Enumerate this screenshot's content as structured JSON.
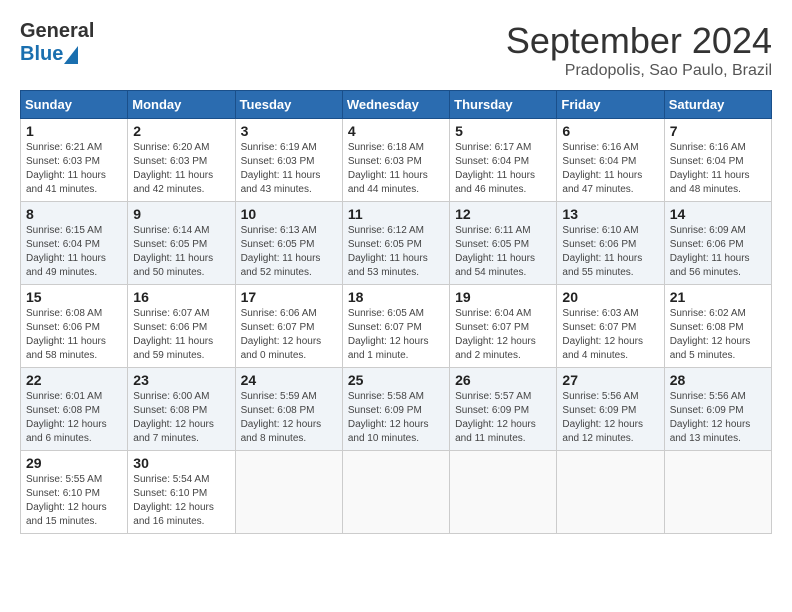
{
  "header": {
    "logo_line1": "General",
    "logo_line2": "Blue",
    "month": "September 2024",
    "location": "Pradopolis, Sao Paulo, Brazil"
  },
  "days_of_week": [
    "Sunday",
    "Monday",
    "Tuesday",
    "Wednesday",
    "Thursday",
    "Friday",
    "Saturday"
  ],
  "weeks": [
    [
      {
        "day": "1",
        "info": "Sunrise: 6:21 AM\nSunset: 6:03 PM\nDaylight: 11 hours\nand 41 minutes."
      },
      {
        "day": "2",
        "info": "Sunrise: 6:20 AM\nSunset: 6:03 PM\nDaylight: 11 hours\nand 42 minutes."
      },
      {
        "day": "3",
        "info": "Sunrise: 6:19 AM\nSunset: 6:03 PM\nDaylight: 11 hours\nand 43 minutes."
      },
      {
        "day": "4",
        "info": "Sunrise: 6:18 AM\nSunset: 6:03 PM\nDaylight: 11 hours\nand 44 minutes."
      },
      {
        "day": "5",
        "info": "Sunrise: 6:17 AM\nSunset: 6:04 PM\nDaylight: 11 hours\nand 46 minutes."
      },
      {
        "day": "6",
        "info": "Sunrise: 6:16 AM\nSunset: 6:04 PM\nDaylight: 11 hours\nand 47 minutes."
      },
      {
        "day": "7",
        "info": "Sunrise: 6:16 AM\nSunset: 6:04 PM\nDaylight: 11 hours\nand 48 minutes."
      }
    ],
    [
      {
        "day": "8",
        "info": "Sunrise: 6:15 AM\nSunset: 6:04 PM\nDaylight: 11 hours\nand 49 minutes."
      },
      {
        "day": "9",
        "info": "Sunrise: 6:14 AM\nSunset: 6:05 PM\nDaylight: 11 hours\nand 50 minutes."
      },
      {
        "day": "10",
        "info": "Sunrise: 6:13 AM\nSunset: 6:05 PM\nDaylight: 11 hours\nand 52 minutes."
      },
      {
        "day": "11",
        "info": "Sunrise: 6:12 AM\nSunset: 6:05 PM\nDaylight: 11 hours\nand 53 minutes."
      },
      {
        "day": "12",
        "info": "Sunrise: 6:11 AM\nSunset: 6:05 PM\nDaylight: 11 hours\nand 54 minutes."
      },
      {
        "day": "13",
        "info": "Sunrise: 6:10 AM\nSunset: 6:06 PM\nDaylight: 11 hours\nand 55 minutes."
      },
      {
        "day": "14",
        "info": "Sunrise: 6:09 AM\nSunset: 6:06 PM\nDaylight: 11 hours\nand 56 minutes."
      }
    ],
    [
      {
        "day": "15",
        "info": "Sunrise: 6:08 AM\nSunset: 6:06 PM\nDaylight: 11 hours\nand 58 minutes."
      },
      {
        "day": "16",
        "info": "Sunrise: 6:07 AM\nSunset: 6:06 PM\nDaylight: 11 hours\nand 59 minutes."
      },
      {
        "day": "17",
        "info": "Sunrise: 6:06 AM\nSunset: 6:07 PM\nDaylight: 12 hours\nand 0 minutes."
      },
      {
        "day": "18",
        "info": "Sunrise: 6:05 AM\nSunset: 6:07 PM\nDaylight: 12 hours\nand 1 minute."
      },
      {
        "day": "19",
        "info": "Sunrise: 6:04 AM\nSunset: 6:07 PM\nDaylight: 12 hours\nand 2 minutes."
      },
      {
        "day": "20",
        "info": "Sunrise: 6:03 AM\nSunset: 6:07 PM\nDaylight: 12 hours\nand 4 minutes."
      },
      {
        "day": "21",
        "info": "Sunrise: 6:02 AM\nSunset: 6:08 PM\nDaylight: 12 hours\nand 5 minutes."
      }
    ],
    [
      {
        "day": "22",
        "info": "Sunrise: 6:01 AM\nSunset: 6:08 PM\nDaylight: 12 hours\nand 6 minutes."
      },
      {
        "day": "23",
        "info": "Sunrise: 6:00 AM\nSunset: 6:08 PM\nDaylight: 12 hours\nand 7 minutes."
      },
      {
        "day": "24",
        "info": "Sunrise: 5:59 AM\nSunset: 6:08 PM\nDaylight: 12 hours\nand 8 minutes."
      },
      {
        "day": "25",
        "info": "Sunrise: 5:58 AM\nSunset: 6:09 PM\nDaylight: 12 hours\nand 10 minutes."
      },
      {
        "day": "26",
        "info": "Sunrise: 5:57 AM\nSunset: 6:09 PM\nDaylight: 12 hours\nand 11 minutes."
      },
      {
        "day": "27",
        "info": "Sunrise: 5:56 AM\nSunset: 6:09 PM\nDaylight: 12 hours\nand 12 minutes."
      },
      {
        "day": "28",
        "info": "Sunrise: 5:56 AM\nSunset: 6:09 PM\nDaylight: 12 hours\nand 13 minutes."
      }
    ],
    [
      {
        "day": "29",
        "info": "Sunrise: 5:55 AM\nSunset: 6:10 PM\nDaylight: 12 hours\nand 15 minutes."
      },
      {
        "day": "30",
        "info": "Sunrise: 5:54 AM\nSunset: 6:10 PM\nDaylight: 12 hours\nand 16 minutes."
      },
      {
        "day": "",
        "info": ""
      },
      {
        "day": "",
        "info": ""
      },
      {
        "day": "",
        "info": ""
      },
      {
        "day": "",
        "info": ""
      },
      {
        "day": "",
        "info": ""
      }
    ]
  ]
}
